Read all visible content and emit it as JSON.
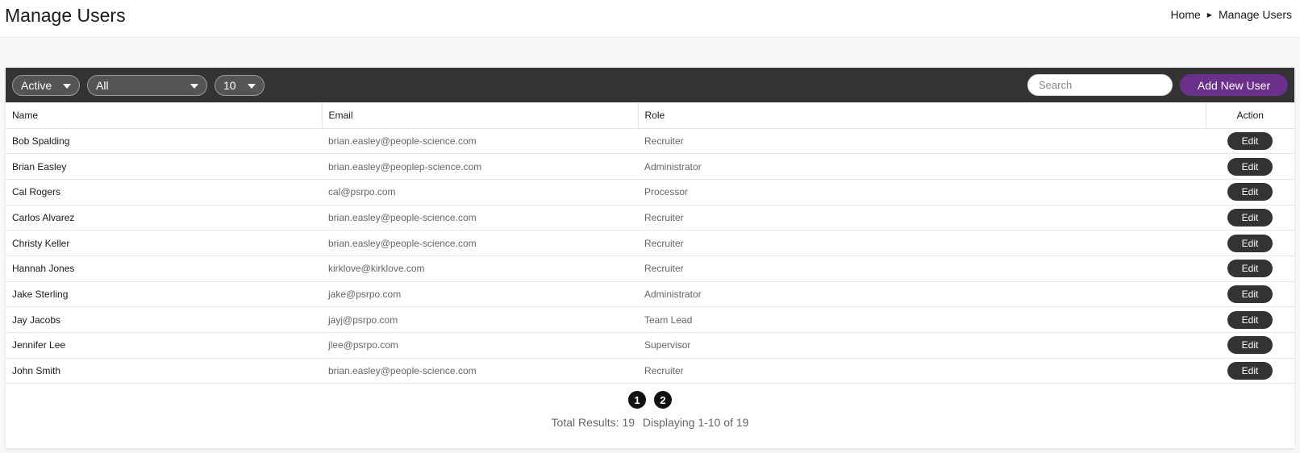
{
  "header": {
    "title": "Manage Users",
    "breadcrumb": [
      {
        "label": "Home"
      },
      {
        "label": "Manage Users"
      }
    ]
  },
  "toolbar": {
    "status_filter": "Active",
    "role_filter": "All",
    "page_size": "10",
    "search_placeholder": "Search",
    "add_button": "Add New User"
  },
  "table": {
    "columns": {
      "name": "Name",
      "email": "Email",
      "role": "Role",
      "action": "Action"
    },
    "rows": [
      {
        "name": "Bob Spalding",
        "email": "brian.easley@people-science.com",
        "role": "Recruiter",
        "action": "Edit"
      },
      {
        "name": "Brian Easley",
        "email": "brian.easley@peoplep-science.com",
        "role": "Administrator",
        "action": "Edit"
      },
      {
        "name": "Cal Rogers",
        "email": "cal@psrpo.com",
        "role": "Processor",
        "action": "Edit"
      },
      {
        "name": "Carlos Alvarez",
        "email": "brian.easley@people-science.com",
        "role": "Recruiter",
        "action": "Edit"
      },
      {
        "name": "Christy Keller",
        "email": "brian.easley@people-science.com",
        "role": "Recruiter",
        "action": "Edit"
      },
      {
        "name": "Hannah Jones",
        "email": "kirklove@kirklove.com",
        "role": "Recruiter",
        "action": "Edit"
      },
      {
        "name": "Jake Sterling",
        "email": "jake@psrpo.com",
        "role": "Administrator",
        "action": "Edit"
      },
      {
        "name": "Jay Jacobs",
        "email": "jayj@psrpo.com",
        "role": "Team Lead",
        "action": "Edit"
      },
      {
        "name": "Jennifer Lee",
        "email": "jlee@psrpo.com",
        "role": "Supervisor",
        "action": "Edit"
      },
      {
        "name": "John Smith",
        "email": "brian.easley@people-science.com",
        "role": "Recruiter",
        "action": "Edit"
      }
    ]
  },
  "pagination": {
    "pages": [
      "1",
      "2"
    ],
    "total_results": "Total Results: 19",
    "displaying": "Displaying 1-10 of 19"
  },
  "colors": {
    "toolbar_bg": "#333333",
    "accent": "#6b2f8c"
  }
}
